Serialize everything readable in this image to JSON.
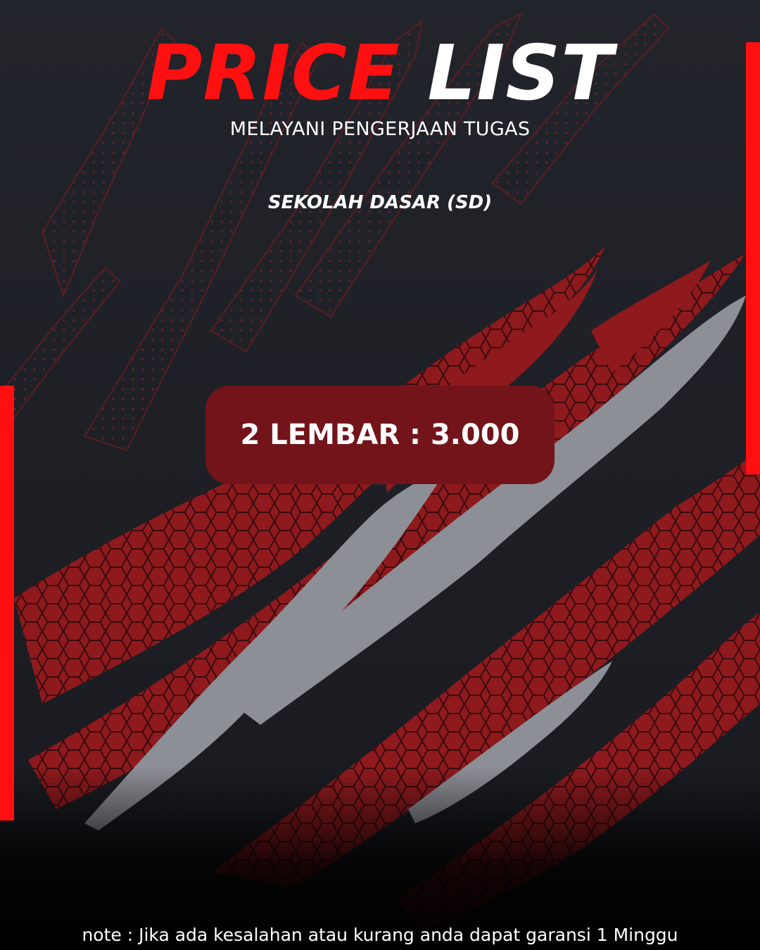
{
  "header": {
    "title_part1": "PRICE",
    "title_part2": "LIST",
    "subtitle": "MELAYANI PENGERJAAN TUGAS"
  },
  "category": {
    "label": "SEKOLAH DASAR (SD)"
  },
  "price": {
    "label": "2 LEMBAR : 3.000"
  },
  "footer": {
    "note": "note : Jika ada kesalahan atau kurang anda dapat garansi 1 Minggu"
  },
  "colors": {
    "background": "#1c1e24",
    "accent_red": "#ff1010",
    "price_box": "#72141a",
    "claw_red": "#8e1a1d",
    "claw_silver": "#8d8f96",
    "text": "#ffffff"
  }
}
